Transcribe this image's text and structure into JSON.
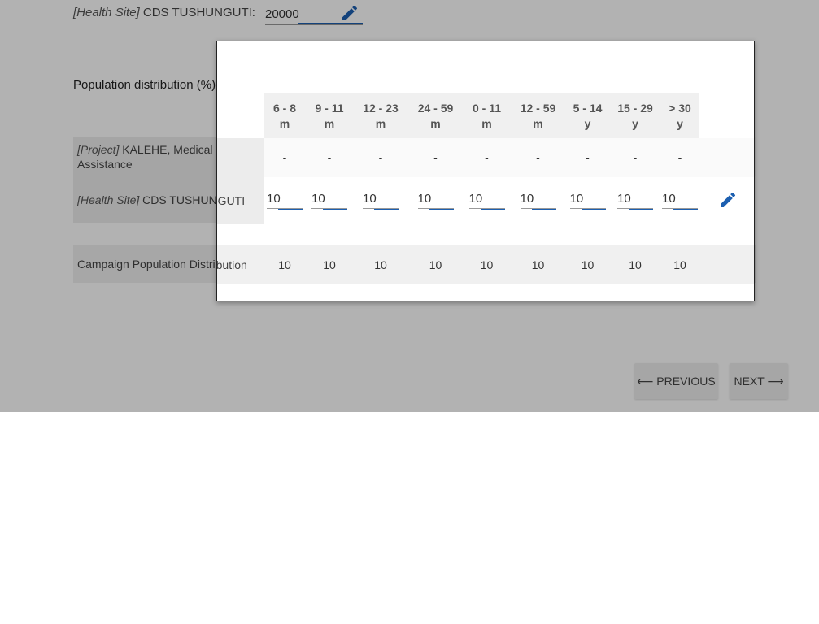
{
  "health_site_field": {
    "tag": "[Health Site]",
    "name": "CDS TUSHUNGUTI:",
    "value": "20000"
  },
  "population_distribution": {
    "title": "Population distribution (%)",
    "columns": [
      {
        "top": "6 - 8",
        "bottom": "m"
      },
      {
        "top": "9 - 11",
        "bottom": "m"
      },
      {
        "top": "12 - 23",
        "bottom": "m"
      },
      {
        "top": "24 - 59",
        "bottom": "m"
      },
      {
        "top": "0 - 11",
        "bottom": "m"
      },
      {
        "top": "12 - 59",
        "bottom": "m"
      },
      {
        "top": "5 - 14",
        "bottom": "y"
      },
      {
        "top": "15 - 29",
        "bottom": "y"
      },
      {
        "top": "> 30",
        "bottom": "y"
      }
    ],
    "project_row": {
      "tag": "[Project]",
      "name": "KALEHE, Medical Assistance",
      "values": [
        "-",
        "-",
        "-",
        "-",
        "-",
        "-",
        "-",
        "-",
        "-"
      ]
    },
    "health_site_row": {
      "tag": "[Health Site]",
      "name": "CDS TUSHUNGUTI",
      "values": [
        "10",
        "10",
        "10",
        "10",
        "10",
        "10",
        "10",
        "10",
        "10"
      ]
    },
    "campaign_row": {
      "name": "Campaign Population Distribution",
      "values": [
        "10",
        "10",
        "10",
        "10",
        "10",
        "10",
        "10",
        "10",
        "10"
      ]
    }
  },
  "navigation": {
    "previous_label": "⟵ PREVIOUS",
    "next_label": "NEXT ⟶"
  },
  "colors": {
    "accent": "#1c5fb0",
    "overlay": "rgba(0,0,0,0.30)"
  },
  "icons": {
    "edit": "pencil-icon"
  }
}
